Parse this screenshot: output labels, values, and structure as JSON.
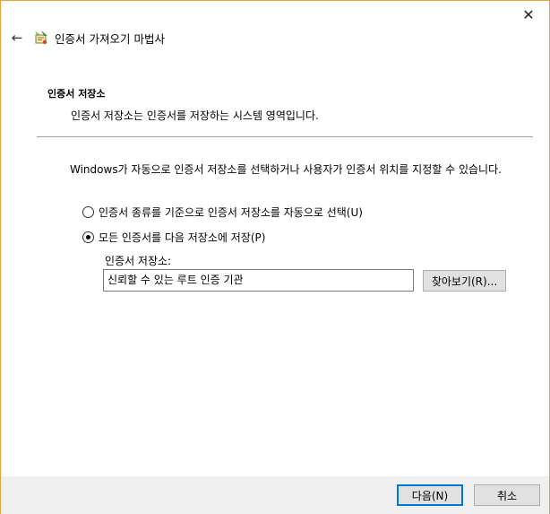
{
  "window": {
    "close_glyph": "✕",
    "back_glyph": "←",
    "title": "인증서 가져오기 마법사",
    "accent_border": "#e8a33d"
  },
  "page": {
    "section_title": "인증서 저장소",
    "section_desc": "인증서 저장소는 인증서를 저장하는 시스템 영역입니다.",
    "instruction": "Windows가 자동으로 인증서 저장소를 선택하거나 사용자가 인증서 위치를 지정할 수 있습니다."
  },
  "options": {
    "auto_label": "인증서 종류를 기준으로 인증서 저장소를 자동으로 선택(U)",
    "auto_checked": false,
    "manual_label": "모든 인증서를 다음 저장소에 저장(P)",
    "manual_checked": true
  },
  "store": {
    "label": "인증서 저장소:",
    "value": "신뢰할 수 있는 루트 인증 기관",
    "browse_label": "찾아보기(R)..."
  },
  "footer": {
    "next_label": "다음(N)",
    "cancel_label": "취소"
  }
}
